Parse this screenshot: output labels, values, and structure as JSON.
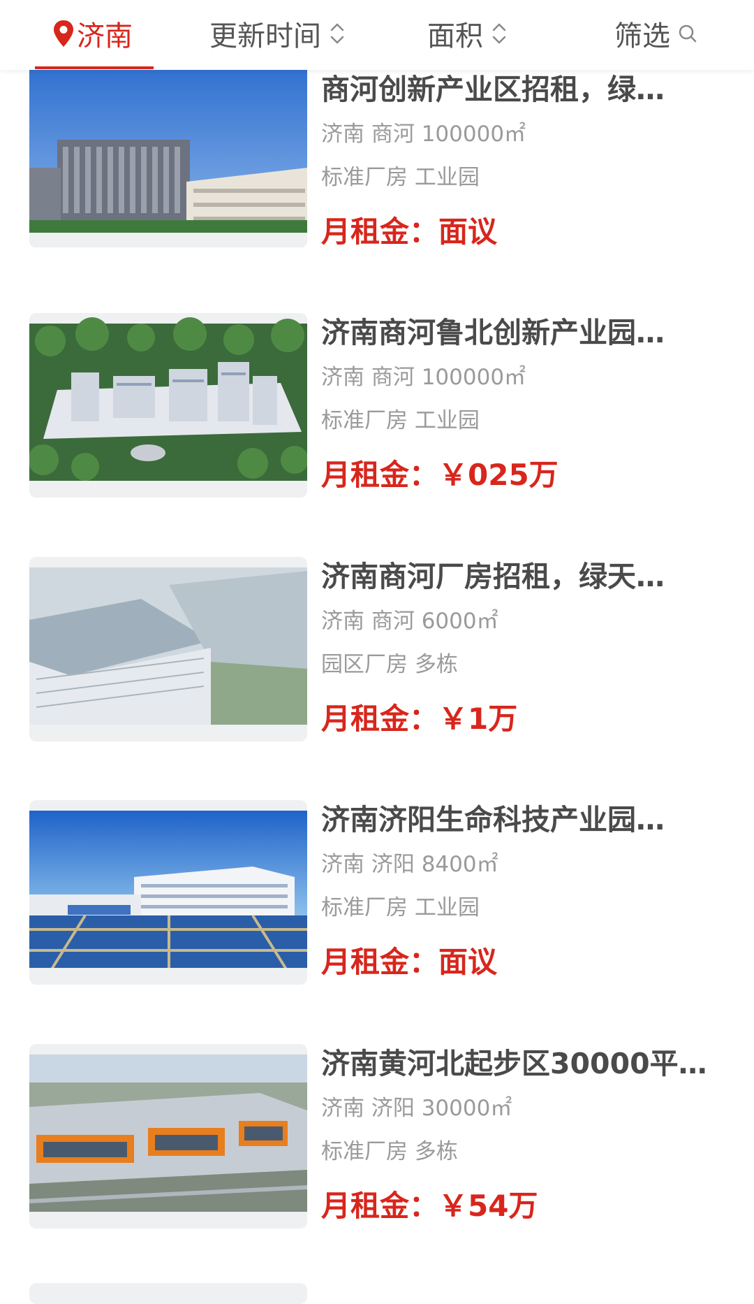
{
  "filter_bar": {
    "city": "济南",
    "sort_time": "更新时间",
    "area": "面积",
    "filter": "筛选",
    "accent": "#d8261c"
  },
  "listings": [
    {
      "title": "商河创新产业区招租，绿…",
      "meta": "济南 商河 100000㎡",
      "tags": "标准厂房 工业园",
      "price": "月租金：面议"
    },
    {
      "title": "济南商河鲁北创新产业园…",
      "meta": "济南 商河 100000㎡",
      "tags": "标准厂房 工业园",
      "price": "月租金：￥025万"
    },
    {
      "title": "济南商河厂房招租，绿天…",
      "meta": "济南 商河 6000㎡",
      "tags": "园区厂房 多栋",
      "price": "月租金：￥1万"
    },
    {
      "title": "济南济阳生命科技产业园…",
      "meta": "济南 济阳 8400㎡",
      "tags": "标准厂房 工业园",
      "price": "月租金：面议"
    },
    {
      "title": "济南黄河北起步区30000平…",
      "meta": "济南 济阳 30000㎡",
      "tags": "标准厂房 多栋",
      "price": "月租金：￥54万"
    }
  ]
}
